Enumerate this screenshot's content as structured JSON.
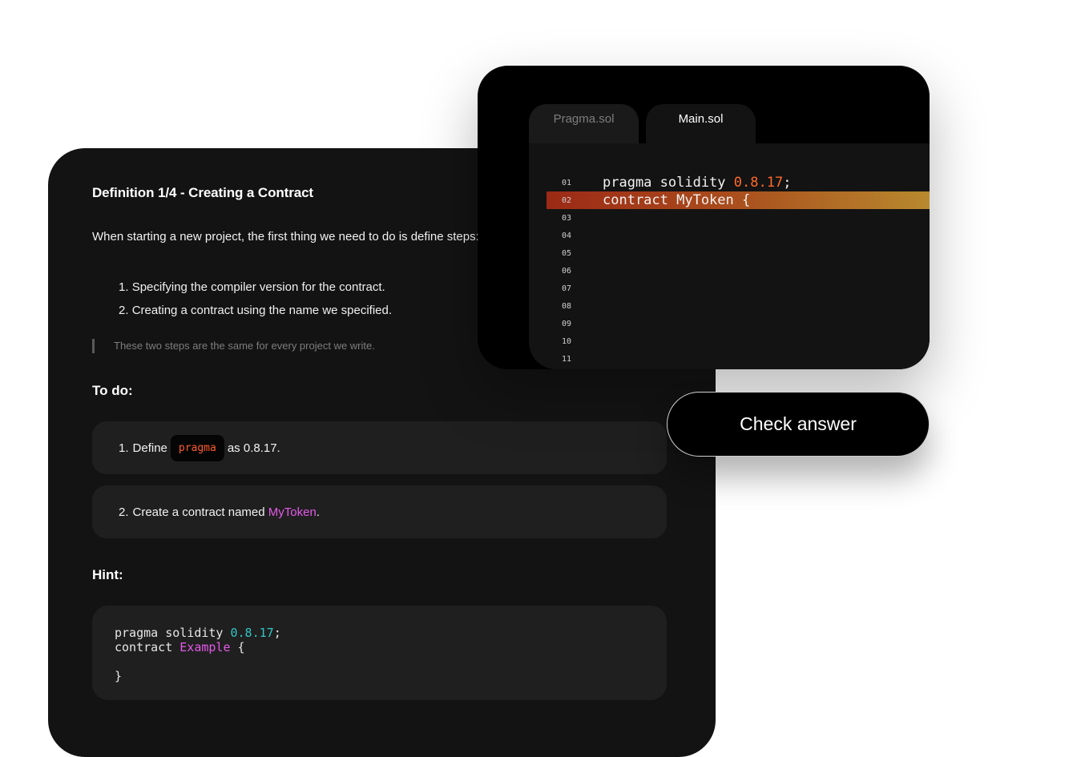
{
  "lesson": {
    "title": "Definition 1/4 - Creating a Contract",
    "intro": "When starting a new project, the first thing we need to do is define steps:",
    "steps": [
      {
        "num": "1.",
        "text": "Specifying the compiler version for the contract."
      },
      {
        "num": "2.",
        "text": "Creating a contract using the name we specified."
      }
    ],
    "note": "These two steps are the same for every project we write.",
    "todo_heading": "To do:",
    "todos": [
      {
        "num": "1.",
        "before": "Define",
        "chip": "pragma",
        "after": "as 0.8.17."
      },
      {
        "num": "2.",
        "before": "Create a contract named",
        "highlight": "MyToken",
        "after": "."
      }
    ],
    "hint_heading": "Hint:",
    "hint_code": {
      "line1_kw": "pragma solidity ",
      "line1_ver": "0.8.17",
      "line1_end": ";",
      "line2_kw": "contract ",
      "line2_name": "Example",
      "line2_end": " {",
      "line4": "}"
    }
  },
  "editor": {
    "tabs": [
      {
        "label": "Pragma.sol",
        "active": false
      },
      {
        "label": "Main.sol",
        "active": true
      }
    ],
    "lines": [
      {
        "num": "01",
        "kw": "pragma solidity ",
        "ver": "0.8.17",
        "end": ";"
      },
      {
        "num": "02",
        "text": "contract MyToken {",
        "highlighted": true
      },
      {
        "num": "03",
        "text": ""
      },
      {
        "num": "04",
        "text": ""
      },
      {
        "num": "05",
        "text": ""
      },
      {
        "num": "06",
        "text": ""
      },
      {
        "num": "07",
        "text": ""
      },
      {
        "num": "08",
        "text": ""
      },
      {
        "num": "09",
        "text": ""
      },
      {
        "num": "10",
        "text": ""
      },
      {
        "num": "11",
        "text": ""
      }
    ]
  },
  "check_button": {
    "label": "Check answer"
  },
  "colors": {
    "panel_bg": "#131313",
    "card_bg": "#1f1f1f",
    "chip_text": "#ff5a2a",
    "name_magenta": "#e45ae9",
    "hint_version_cyan": "#34c4c4",
    "highlight_start": "#9c2a16",
    "highlight_end": "#b8892e"
  }
}
